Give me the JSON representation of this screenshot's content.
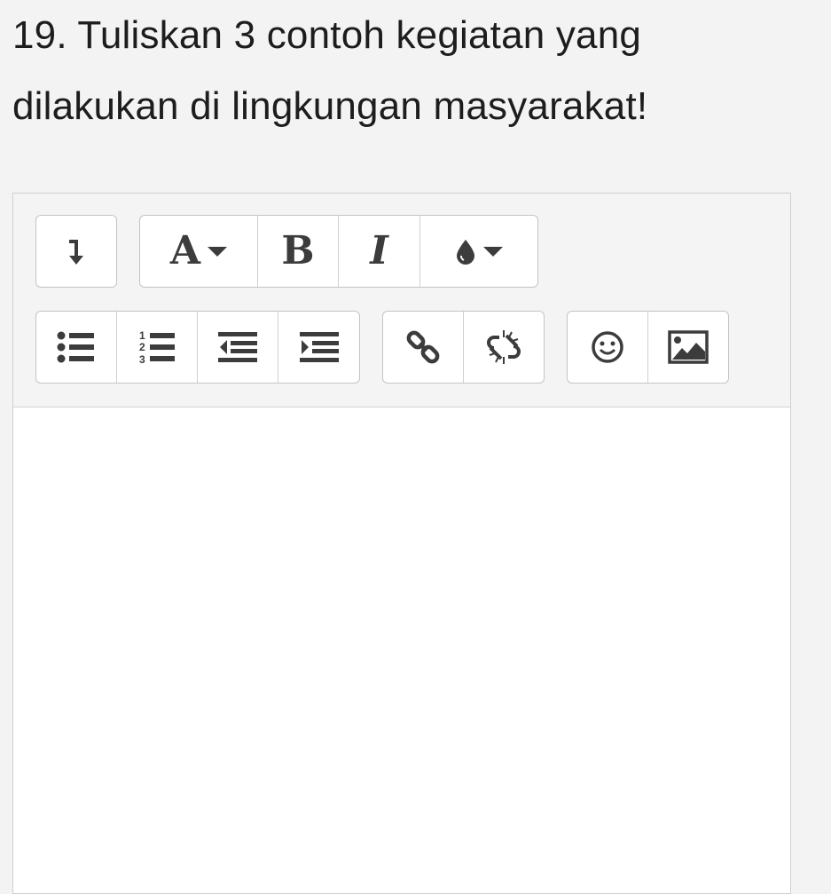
{
  "question": {
    "line1": "19.  Tuliskan 3 contoh kegiatan yang",
    "line2": "dilakukan di lingkungan masyarakat!"
  },
  "toolbar": {
    "row1": [
      {
        "name": "toolbar-toggle-button",
        "icon": "level-down-icon"
      },
      {
        "name": "paragraph-style-button",
        "label": "A",
        "icon": "caret-down-icon"
      },
      {
        "name": "bold-button",
        "label": "B"
      },
      {
        "name": "italic-button",
        "label": "I"
      },
      {
        "name": "text-color-button",
        "icon": "tint-icon"
      }
    ],
    "row2": [
      {
        "name": "unordered-list-button",
        "icon": "list-ul-icon"
      },
      {
        "name": "ordered-list-button",
        "icon": "list-ol-icon"
      },
      {
        "name": "outdent-button",
        "icon": "outdent-icon"
      },
      {
        "name": "indent-button",
        "icon": "indent-icon"
      },
      {
        "name": "link-button",
        "icon": "link-icon"
      },
      {
        "name": "unlink-button",
        "icon": "unlink-icon"
      },
      {
        "name": "emoticon-button",
        "icon": "smile-icon"
      },
      {
        "name": "image-button",
        "icon": "image-icon"
      }
    ]
  },
  "editor": {
    "content": ""
  },
  "colors": {
    "icon": "#3c3c3c",
    "toolbar_bg": "#f4f4f4",
    "page_bg": "#f3f3f3",
    "border": "#c4c4c4"
  }
}
